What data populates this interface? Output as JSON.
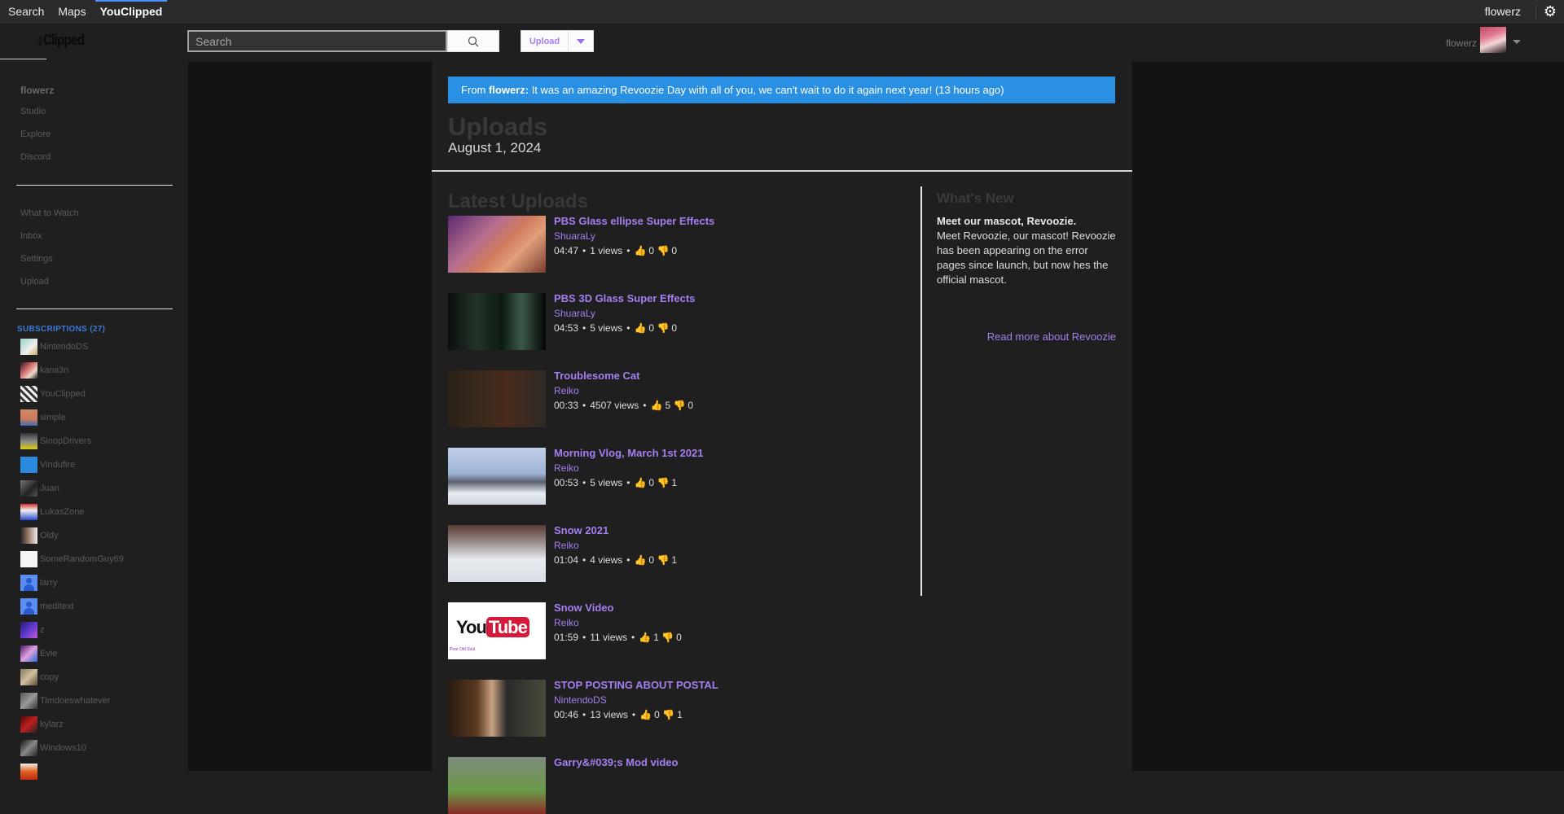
{
  "topbar": {
    "nav": [
      {
        "label": "Search",
        "active": false
      },
      {
        "label": "Maps",
        "active": false
      },
      {
        "label": "YouClipped",
        "active": true
      }
    ],
    "username": "flowerz",
    "settings_icon": "gear-icon"
  },
  "header": {
    "logo_prefix": "You",
    "logo_text": "Clipped",
    "search_placeholder": "Search",
    "search_icon": "search-icon",
    "upload_label": "Upload",
    "username": "flowerz"
  },
  "sidebar": {
    "username": "flowerz",
    "primary": [
      "Studio",
      "Explore",
      "Discord"
    ],
    "secondary": [
      "What to Watch",
      "Inbox",
      "Settings",
      "Upload"
    ],
    "subscriptions_label": "SUBSCRIPTIONS (27)",
    "subscriptions": [
      "NintendoDS",
      "kans3n",
      "YouClipped",
      "simple",
      "SinopDrivers",
      "Vindufire",
      "Juan",
      "LukasZone",
      "Oldy",
      "SomeRandomGuy69",
      "larry",
      "meditext",
      "z",
      "Evie",
      "copy",
      "Timdoeswhatever",
      "kylarz",
      "Windows10",
      ""
    ]
  },
  "announcement": {
    "prefix": "From ",
    "author": "flowerz:",
    "message": " It was an amazing Revoozie Day with all of you, we can't wait to do it again next year! (13 hours ago)",
    "color": "#2a90e3"
  },
  "page": {
    "title": "Uploads",
    "date": "August 1, 2024"
  },
  "latest": {
    "heading": "Latest Uploads",
    "videos": [
      {
        "title": "PBS Glass ellipse Super Effects",
        "author": "ShuaraLy",
        "duration": "04:47",
        "views": "1 views",
        "likes": "0",
        "dislikes": "0"
      },
      {
        "title": "PBS 3D Glass Super Effects",
        "author": "ShuaraLy",
        "duration": "04:53",
        "views": "5 views",
        "likes": "0",
        "dislikes": "0"
      },
      {
        "title": "Troublesome Cat",
        "author": "Reiko",
        "duration": "00:33",
        "views": "4507 views",
        "likes": "5",
        "dislikes": "0"
      },
      {
        "title": "Morning Vlog, March 1st 2021",
        "author": "Reiko",
        "duration": "00:53",
        "views": "5 views",
        "likes": "0",
        "dislikes": "1"
      },
      {
        "title": "Snow 2021",
        "author": "Reiko",
        "duration": "01:04",
        "views": "4 views",
        "likes": "0",
        "dislikes": "1"
      },
      {
        "title": "Snow Video",
        "author": "Reiko",
        "duration": "01:59",
        "views": "11 views",
        "likes": "1",
        "dislikes": "0"
      },
      {
        "title": "STOP POSTING ABOUT POSTAL",
        "author": "NintendoDS",
        "duration": "00:46",
        "views": "13 views",
        "likes": "0",
        "dislikes": "1"
      },
      {
        "title": "Garry&#039;s Mod video",
        "author": "",
        "duration": "",
        "views": "",
        "likes": "",
        "dislikes": ""
      }
    ],
    "thumb6_logo_you": "You",
    "thumb6_logo_tube": "Tube",
    "thumb6_caption": "Poor Old Soul"
  },
  "whats_new": {
    "heading": "What's New",
    "subheading": "Meet our mascot, Revoozie.",
    "body": "Meet Revoozie, our mascot! Revoozie has been appearing on the error pages since launch, but now hes the official mascot.",
    "link": "Read more about Revoozie"
  },
  "colors": {
    "accent": "#a57ff0",
    "announcement": "#2a90e3",
    "subscriptions": "#3a79d8"
  },
  "icons": {
    "separator": "•",
    "like": "👍",
    "dislike": "👎",
    "gear": "⚙"
  }
}
